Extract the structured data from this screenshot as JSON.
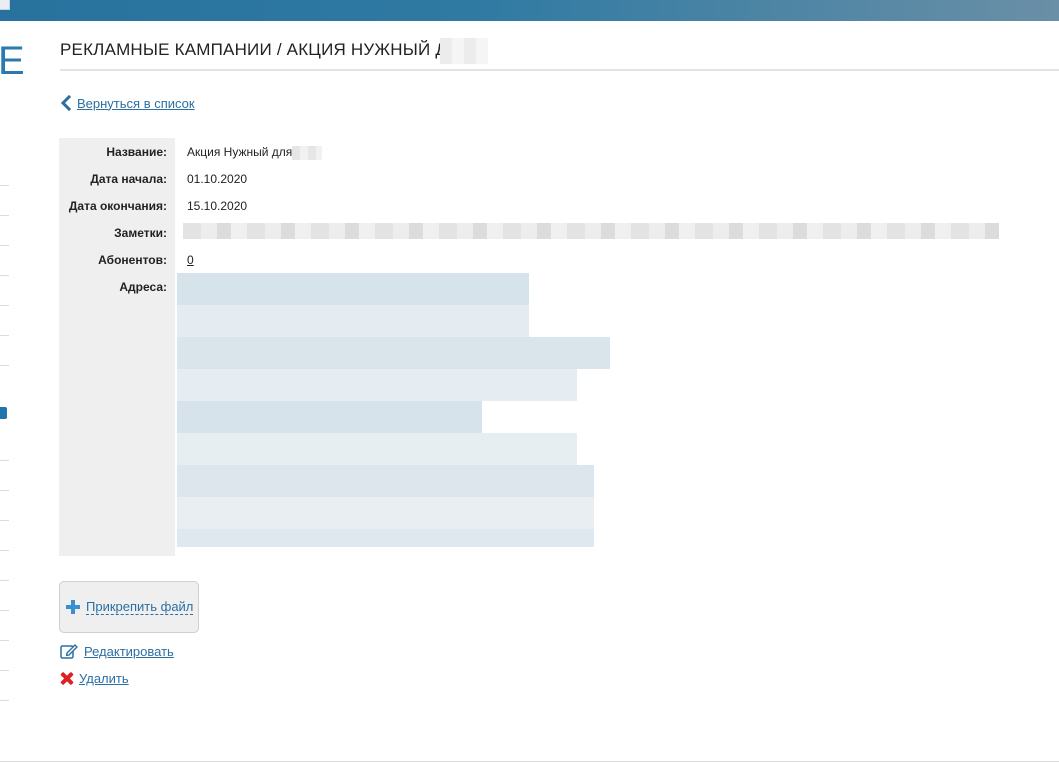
{
  "header": {
    "title": "РЕКЛАМНЫЕ КАМПАНИИ / АКЦИЯ НУЖНЫЙ ДЛЯ",
    "back_link": "Вернуться в список"
  },
  "brand": {
    "letter": "E",
    "accent": "#2b6fa3"
  },
  "details": {
    "name_label": "Название:",
    "name_value": "Акция Нужный для",
    "start_label": "Дата начала:",
    "start_value": "01.10.2020",
    "end_label": "Дата окончания:",
    "end_value": "15.10.2020",
    "notes_label": "Заметки:",
    "subscribers_label": "Абонентов:",
    "subscribers_value": "0",
    "addresses_label": "Адреса:"
  },
  "actions": {
    "attach_file": "Прикрепить файл",
    "edit": "Редактировать",
    "delete": "Удалить"
  },
  "icons": {
    "back": "chevron-left-icon",
    "attach": "plus-icon",
    "edit": "edit-icon",
    "delete": "delete-x-icon"
  }
}
